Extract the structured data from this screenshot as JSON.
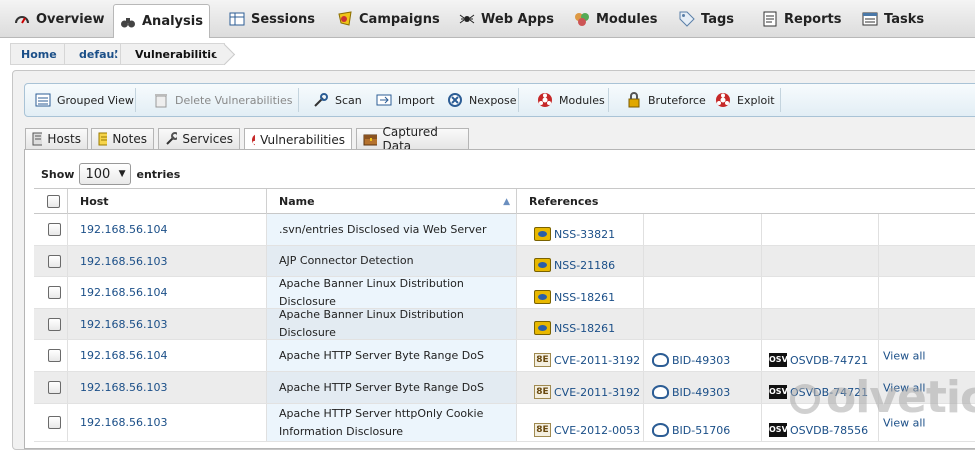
{
  "topnav": {
    "tabs": [
      {
        "label": "Overview",
        "icon": "gauge-icon"
      },
      {
        "label": "Analysis",
        "icon": "binoculars-icon",
        "active": true
      },
      {
        "label": "Sessions",
        "icon": "table-icon"
      },
      {
        "label": "Campaigns",
        "icon": "campaign-icon"
      },
      {
        "label": "Web Apps",
        "icon": "spider-icon"
      },
      {
        "label": "Modules",
        "icon": "modules-icon"
      },
      {
        "label": "Tags",
        "icon": "tag-icon"
      },
      {
        "label": "Reports",
        "icon": "report-icon"
      },
      {
        "label": "Tasks",
        "icon": "tasks-icon"
      }
    ]
  },
  "breadcrumb": [
    "Home",
    "default",
    "Vulnerabilities"
  ],
  "toolbar": {
    "grouped_view": "Grouped View",
    "delete_vulns": "Delete Vulnerabilities",
    "scan": "Scan",
    "import": "Import",
    "nexpose": "Nexpose",
    "modules": "Modules",
    "bruteforce": "Bruteforce",
    "exploit": "Exploit"
  },
  "subtabs": [
    "Hosts",
    "Notes",
    "Services",
    "Vulnerabilities",
    "Captured Data"
  ],
  "table_controls": {
    "show_label": "Show",
    "page_size": "100",
    "entries_label": "entries"
  },
  "columns": [
    "Host",
    "Name",
    "References"
  ],
  "rows": [
    {
      "host": "192.168.56.104",
      "name": ".svn/entries Disclosed via Web Server",
      "refs": [
        {
          "type": "nss",
          "label": "NSS-33821"
        }
      ]
    },
    {
      "host": "192.168.56.103",
      "name": "AJP Connector Detection",
      "refs": [
        {
          "type": "nss",
          "label": "NSS-21186"
        }
      ]
    },
    {
      "host": "192.168.56.104",
      "name": "Apache Banner Linux Distribution Disclosure",
      "refs": [
        {
          "type": "nss",
          "label": "NSS-18261"
        }
      ]
    },
    {
      "host": "192.168.56.103",
      "name": "Apache Banner Linux Distribution Disclosure",
      "refs": [
        {
          "type": "nss",
          "label": "NSS-18261"
        }
      ]
    },
    {
      "host": "192.168.56.104",
      "name": "Apache HTTP Server Byte Range DoS",
      "refs": [
        {
          "type": "cve",
          "label": "CVE-2011-3192"
        },
        {
          "type": "bid",
          "label": "BID-49303"
        },
        {
          "type": "osvdb",
          "label": "OSVDB-74721"
        }
      ],
      "view_all": "View all"
    },
    {
      "host": "192.168.56.103",
      "name": "Apache HTTP Server Byte Range DoS",
      "refs": [
        {
          "type": "cve",
          "label": "CVE-2011-3192"
        },
        {
          "type": "bid",
          "label": "BID-49303"
        },
        {
          "type": "osvdb",
          "label": "OSVDB-74721"
        }
      ],
      "view_all": "View all"
    },
    {
      "host": "192.168.56.103",
      "name": "Apache HTTP Server httpOnly Cookie Information Disclosure",
      "refs": [
        {
          "type": "cve",
          "label": "CVE-2012-0053"
        },
        {
          "type": "bid",
          "label": "BID-51706"
        },
        {
          "type": "osvdb",
          "label": "OSVDB-78556"
        }
      ],
      "view_all": "View all"
    }
  ],
  "watermark": "olvetic"
}
